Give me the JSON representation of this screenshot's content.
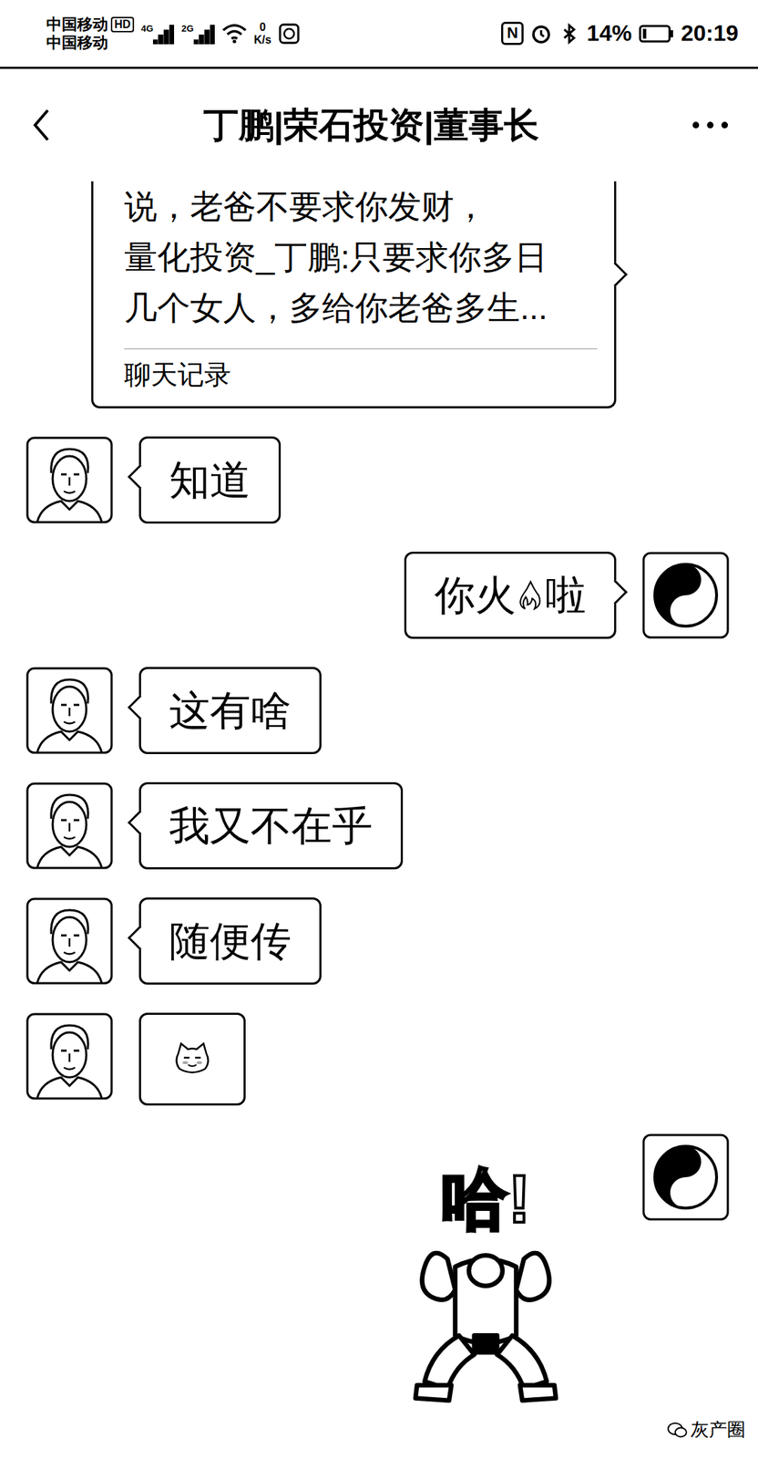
{
  "status_bar": {
    "carrier_top": "中国移动",
    "hd": "HD",
    "carrier_bottom": "中国移动",
    "signals": [
      {
        "label": "4G",
        "level": 1
      },
      {
        "label": "2G",
        "level": 1
      }
    ],
    "wifi_level": 1,
    "speed": "0",
    "speed_unit": "K/s",
    "nfc": "N",
    "battery": "14%",
    "battery_level": 0.14,
    "time": "20:19"
  },
  "chat": {
    "title": "丁鹏|荣石投资|董事长"
  },
  "messages": [
    {
      "side": "right",
      "kind": "record",
      "avatar_shown": false,
      "lines": [
        "说，老爸不要求你发财，",
        "量化投资_丁鹏:只要求你多日",
        "几个女人，多给你老爸多生..."
      ],
      "footer": "聊天记录"
    },
    {
      "side": "left",
      "kind": "text",
      "avatar_shown": true,
      "text": "知道"
    },
    {
      "side": "right",
      "kind": "flame-text",
      "avatar_shown": true,
      "text_before": "你火",
      "text_after": "啦"
    },
    {
      "side": "left",
      "kind": "text",
      "avatar_shown": true,
      "text": "这有啥"
    },
    {
      "side": "left",
      "kind": "text",
      "avatar_shown": true,
      "text": "我又不在乎"
    },
    {
      "side": "left",
      "kind": "text",
      "avatar_shown": true,
      "text": "随便传"
    },
    {
      "side": "left",
      "kind": "cat-sticker",
      "avatar_shown": true
    },
    {
      "side": "right",
      "kind": "muscle-sticker",
      "avatar_shown": true,
      "text": "哈!"
    }
  ],
  "watermark": "灰产圈"
}
